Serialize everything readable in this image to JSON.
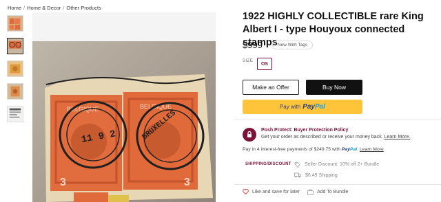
{
  "breadcrumb": {
    "items": [
      "Home",
      "Home & Decor",
      "Other Products"
    ],
    "separator": "/"
  },
  "listing": {
    "title": "1922 HIGHLY COLLECTIBLE rare King Albert I - type Houyoux connected stamps",
    "price": "$999",
    "condition": "New With Tags",
    "size_label": "SIZE",
    "size_value": "OS"
  },
  "buttons": {
    "offer": "Make an Offer",
    "buy": "Buy Now",
    "paypal_prefix": "Pay with",
    "paypal_brand_pay": "Pay",
    "paypal_brand_pal": "Pal"
  },
  "protect": {
    "title": "Posh Protect: Buyer Protection Policy",
    "text": "Get your order as described or receive your money back.",
    "link": "Learn More."
  },
  "installments": {
    "text": "Pay in 4 interest-free payments of $249.75 with",
    "brand_pay": "Pay",
    "brand_pal": "Pal",
    "link": "Learn More"
  },
  "shipping": {
    "label": "SHIPPING/DISCOUNT",
    "discount": "Seller Discount: 10% off 2+ Bundle",
    "cost": "$6.49 Shipping"
  },
  "actions": {
    "like": "Like and save for later",
    "bundle": "Add To Bundle"
  },
  "stamp_text": {
    "country": "BELGIQUE",
    "postmark_1": "BRUXELLES",
    "date": "11 9 2",
    "value": "3"
  },
  "colors": {
    "accent": "#7b1338",
    "buy_button": "#111111",
    "paypal_yellow": "#ffc439",
    "paypal_blue_dark": "#253b80",
    "paypal_blue_light": "#179bd7",
    "stamp_orange": "#e06a3a"
  },
  "icons": {
    "protect": "shield-lock-icon",
    "discount": "tag-icon",
    "shipping": "truck-icon",
    "like": "heart-icon",
    "bundle": "bundle-icon"
  }
}
